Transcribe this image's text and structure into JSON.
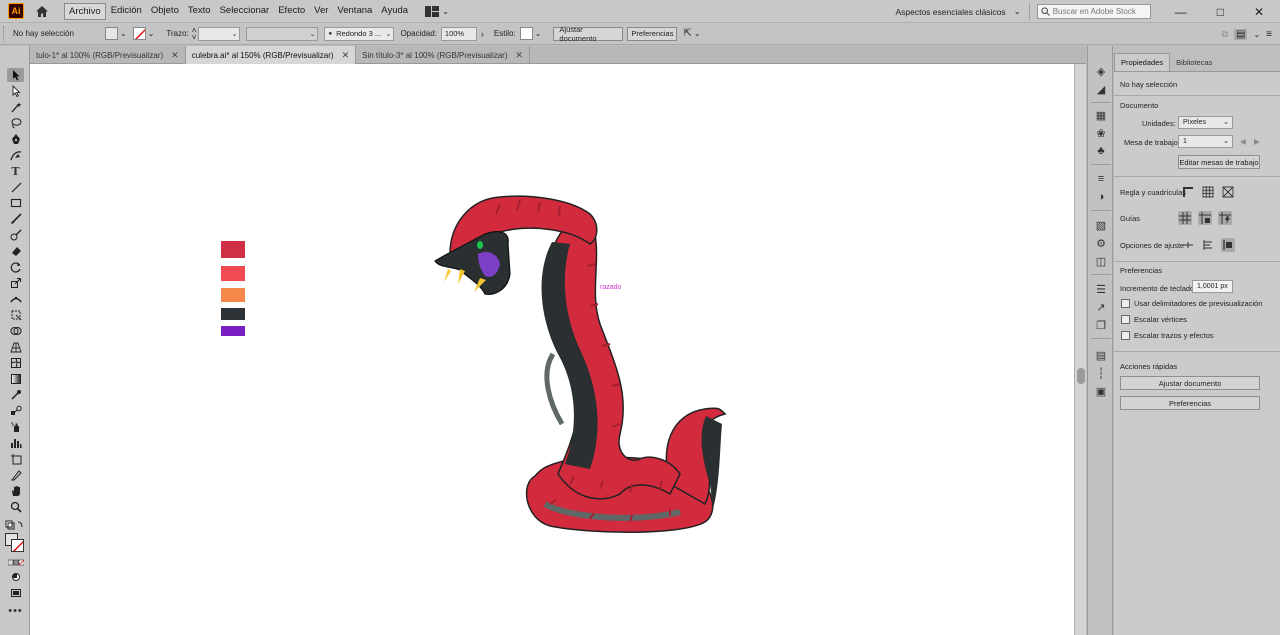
{
  "app": {
    "logo": "Ai",
    "menu": [
      "Archivo",
      "Edición",
      "Objeto",
      "Texto",
      "Seleccionar",
      "Efecto",
      "Ver",
      "Ventana",
      "Ayuda"
    ],
    "workspace": "Aspectos esenciales clásicos",
    "stock_search_placeholder": "Buscar en Adobe Stock"
  },
  "control_bar": {
    "selection_status": "No hay selección",
    "stroke_label": "Trazo:",
    "brush_value": "Redondo 3 ...",
    "opacity_label": "Opacidad:",
    "opacity_value": "100%",
    "style_label": "Estilo:",
    "fit_document_button": "Ajustar documento",
    "preferences_button": "Preferencias"
  },
  "tabs": [
    {
      "label": "tulo-1* al 100% (RGB/Previsualizar)",
      "active": false
    },
    {
      "label": "culebra.ai* al 150% (RGB/Previsualizar)",
      "active": true
    },
    {
      "label": "Sin título-3* al 100% (RGB/Previsualizar)",
      "active": false
    }
  ],
  "canvas": {
    "hint_text": "razado",
    "swatches": [
      "#d12f45",
      "#f04a55",
      "#f5884a",
      "#2d3336",
      "#7a1fc2"
    ],
    "snake_colors": {
      "body": "#d12b3d",
      "dark": "#2a2f31",
      "shadow": "#5f6767",
      "eye": "#19c64a",
      "mouth": "#7d3fc8",
      "fang": "#f2c531"
    }
  },
  "properties": {
    "tabs": [
      "Propiedades",
      "Bibliotecas"
    ],
    "no_selection": "No hay selección",
    "document_title": "Documento",
    "units_label": "Unidades:",
    "units_value": "Píxeles",
    "artboard_label": "Mesa de trabajo:",
    "artboard_value": "1",
    "edit_artboards_button": "Editar mesas de trabajo",
    "rulers_label": "Regla y cuadrículas",
    "guides_label": "Guías",
    "snap_label": "Opciones de ajuste",
    "preferences_title": "Preferencias",
    "keyboard_increment_label": "Incremento de teclado:",
    "keyboard_increment_value": "1,0001 px",
    "check_preview_bounds": "Usar delimitadores de previsualización",
    "check_scale_corners": "Escalar vértices",
    "check_scale_strokes": "Escalar trazos y efectos",
    "quick_actions_title": "Acciones rápidas",
    "quick_fit_button": "Ajustar documento",
    "quick_prefs_button": "Preferencias"
  }
}
